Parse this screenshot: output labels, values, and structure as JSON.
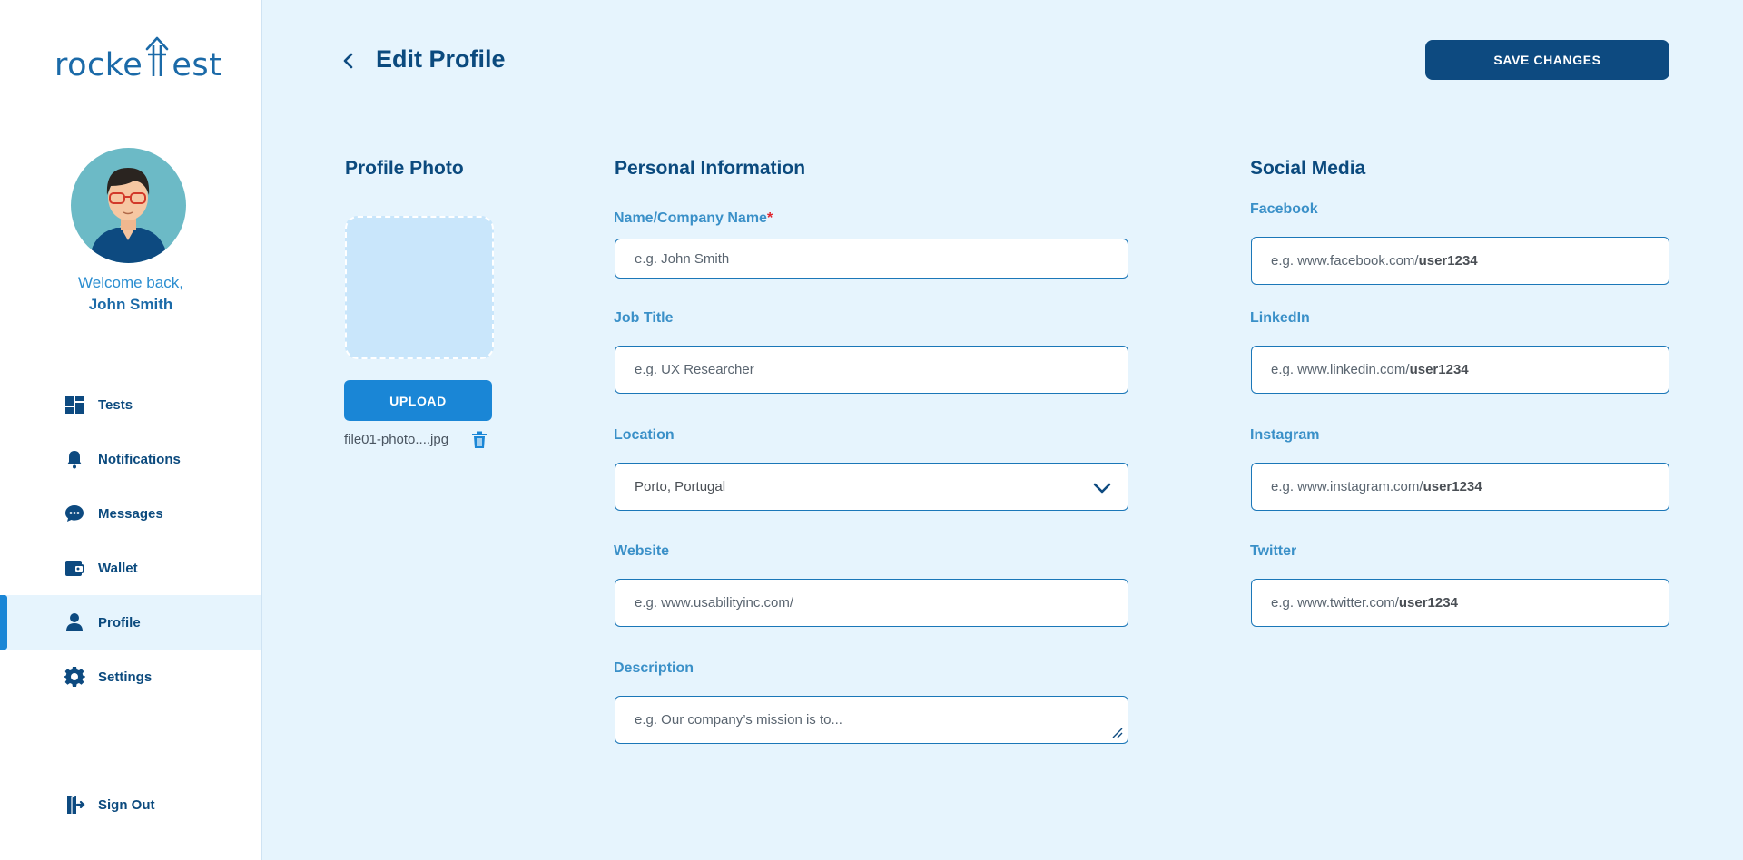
{
  "brand": {
    "logo_text_left": "rocke",
    "logo_text_right": "est"
  },
  "colors": {
    "primary": "#0d4a80",
    "accent": "#1a86d6",
    "label": "#3a90c8",
    "background": "#e6f4fd"
  },
  "user": {
    "welcome": "Welcome back,",
    "name": "John Smith"
  },
  "sidebar": {
    "items": [
      {
        "label": "Tests",
        "icon": "dashboard-icon"
      },
      {
        "label": "Notifications",
        "icon": "bell-icon"
      },
      {
        "label": "Messages",
        "icon": "chat-icon"
      },
      {
        "label": "Wallet",
        "icon": "wallet-icon"
      },
      {
        "label": "Profile",
        "icon": "user-icon",
        "active": true
      },
      {
        "label": "Settings",
        "icon": "gear-icon"
      }
    ],
    "sign_out": {
      "label": "Sign Out",
      "icon": "sign-out-icon"
    }
  },
  "header": {
    "title": "Edit Profile",
    "save_label": "SAVE CHANGES"
  },
  "profile_photo": {
    "title": "Profile Photo",
    "upload_label": "UPLOAD",
    "file_name": "file01-photo....jpg"
  },
  "personal": {
    "title": "Personal Information",
    "name": {
      "label": "Name/Company Name",
      "required": "*",
      "placeholder": "e.g. John Smith"
    },
    "job": {
      "label": "Job Title",
      "placeholder": "e.g. UX Researcher"
    },
    "location": {
      "label": "Location",
      "value": "Porto, Portugal"
    },
    "website": {
      "label": "Website",
      "placeholder": "e.g. www.usabilityinc.com/"
    },
    "description": {
      "label": "Description",
      "placeholder": "e.g. Our company’s mission is to..."
    }
  },
  "social": {
    "title": "Social Media",
    "facebook": {
      "label": "Facebook",
      "prefix": "e.g. www.facebook.com/",
      "user": "user1234"
    },
    "linkedin": {
      "label": "LinkedIn",
      "prefix": "e.g. www.linkedin.com/",
      "user": "user1234"
    },
    "instagram": {
      "label": "Instagram",
      "prefix": "e.g. www.instagram.com/",
      "user": "user1234"
    },
    "twitter": {
      "label": "Twitter",
      "prefix": "e.g. www.twitter.com/",
      "user": "user1234"
    }
  }
}
